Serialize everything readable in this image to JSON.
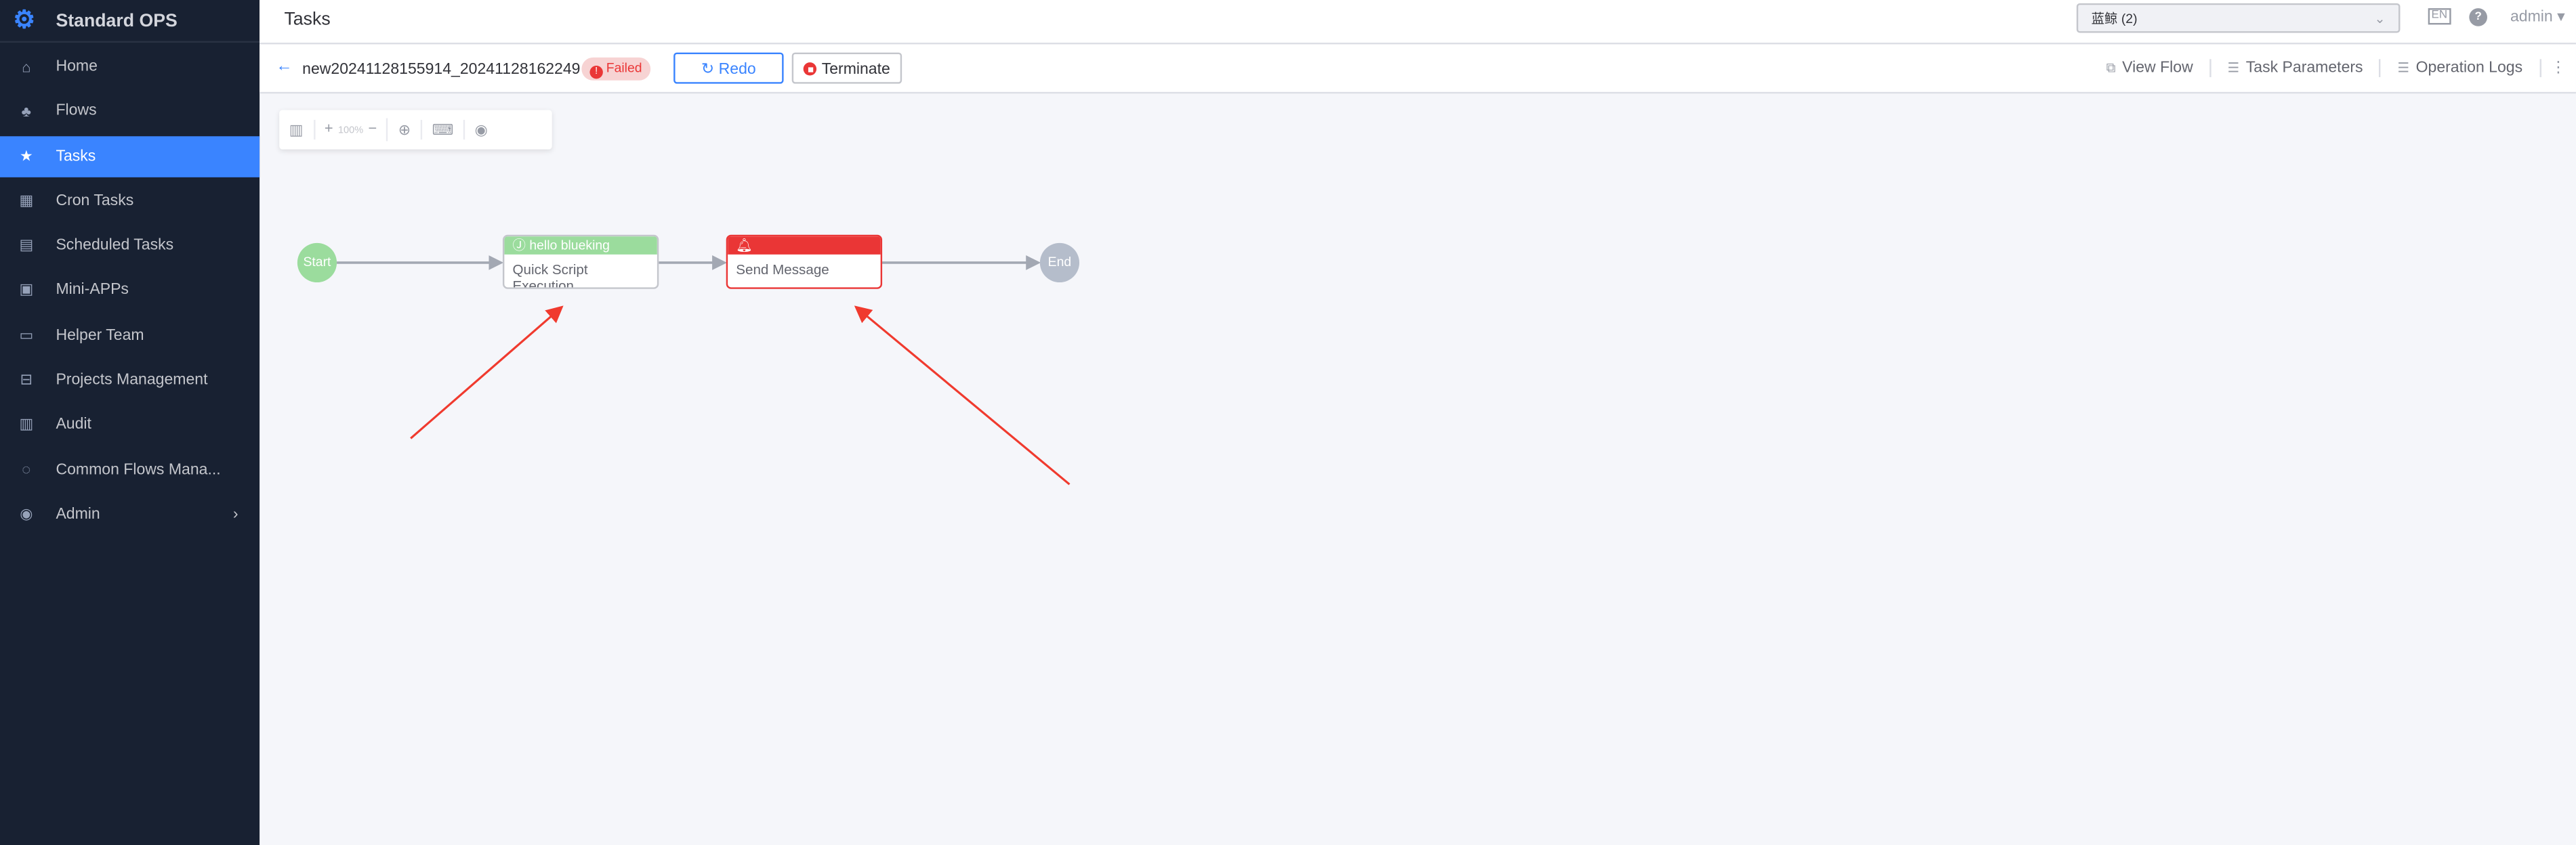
{
  "app": {
    "name": "Standard OPS"
  },
  "sidebar": {
    "items": [
      {
        "label": "Home",
        "icon": "home-icon"
      },
      {
        "label": "Flows",
        "icon": "flows-icon"
      },
      {
        "label": "Tasks",
        "icon": "tasks-icon",
        "active": true
      },
      {
        "label": "Cron Tasks",
        "icon": "cron-icon"
      },
      {
        "label": "Scheduled Tasks",
        "icon": "schedule-icon"
      },
      {
        "label": "Mini-APPs",
        "icon": "apps-icon"
      },
      {
        "label": "Helper Team",
        "icon": "team-icon"
      },
      {
        "label": "Projects Management",
        "icon": "projects-icon"
      },
      {
        "label": "Audit",
        "icon": "audit-icon"
      },
      {
        "label": "Common Flows Mana...",
        "icon": "common-flows-icon"
      },
      {
        "label": "Admin",
        "icon": "admin-icon"
      }
    ]
  },
  "header": {
    "title": "Tasks",
    "project": "蓝鲸 (2)",
    "lang": "EN",
    "help": "?",
    "user": "admin"
  },
  "task": {
    "name": "new20241128155914_20241128162249",
    "status": "Failed",
    "redo": "Redo",
    "terminate": "Terminate",
    "actions": [
      "View Flow",
      "Task Parameters",
      "Operation Logs"
    ]
  },
  "toolbar": {
    "zoom": "100%"
  },
  "flow": {
    "start": "Start",
    "end": "End",
    "nodes": [
      {
        "header": "hello blueking",
        "title": "Quick Script Execution",
        "status": "success"
      },
      {
        "header": "",
        "title": "Send Message",
        "status": "failed"
      }
    ]
  },
  "colors": {
    "accent": "#3a84ff",
    "failed": "#ea3636",
    "success": "#9bdc9d",
    "sidebar": "#182132"
  }
}
